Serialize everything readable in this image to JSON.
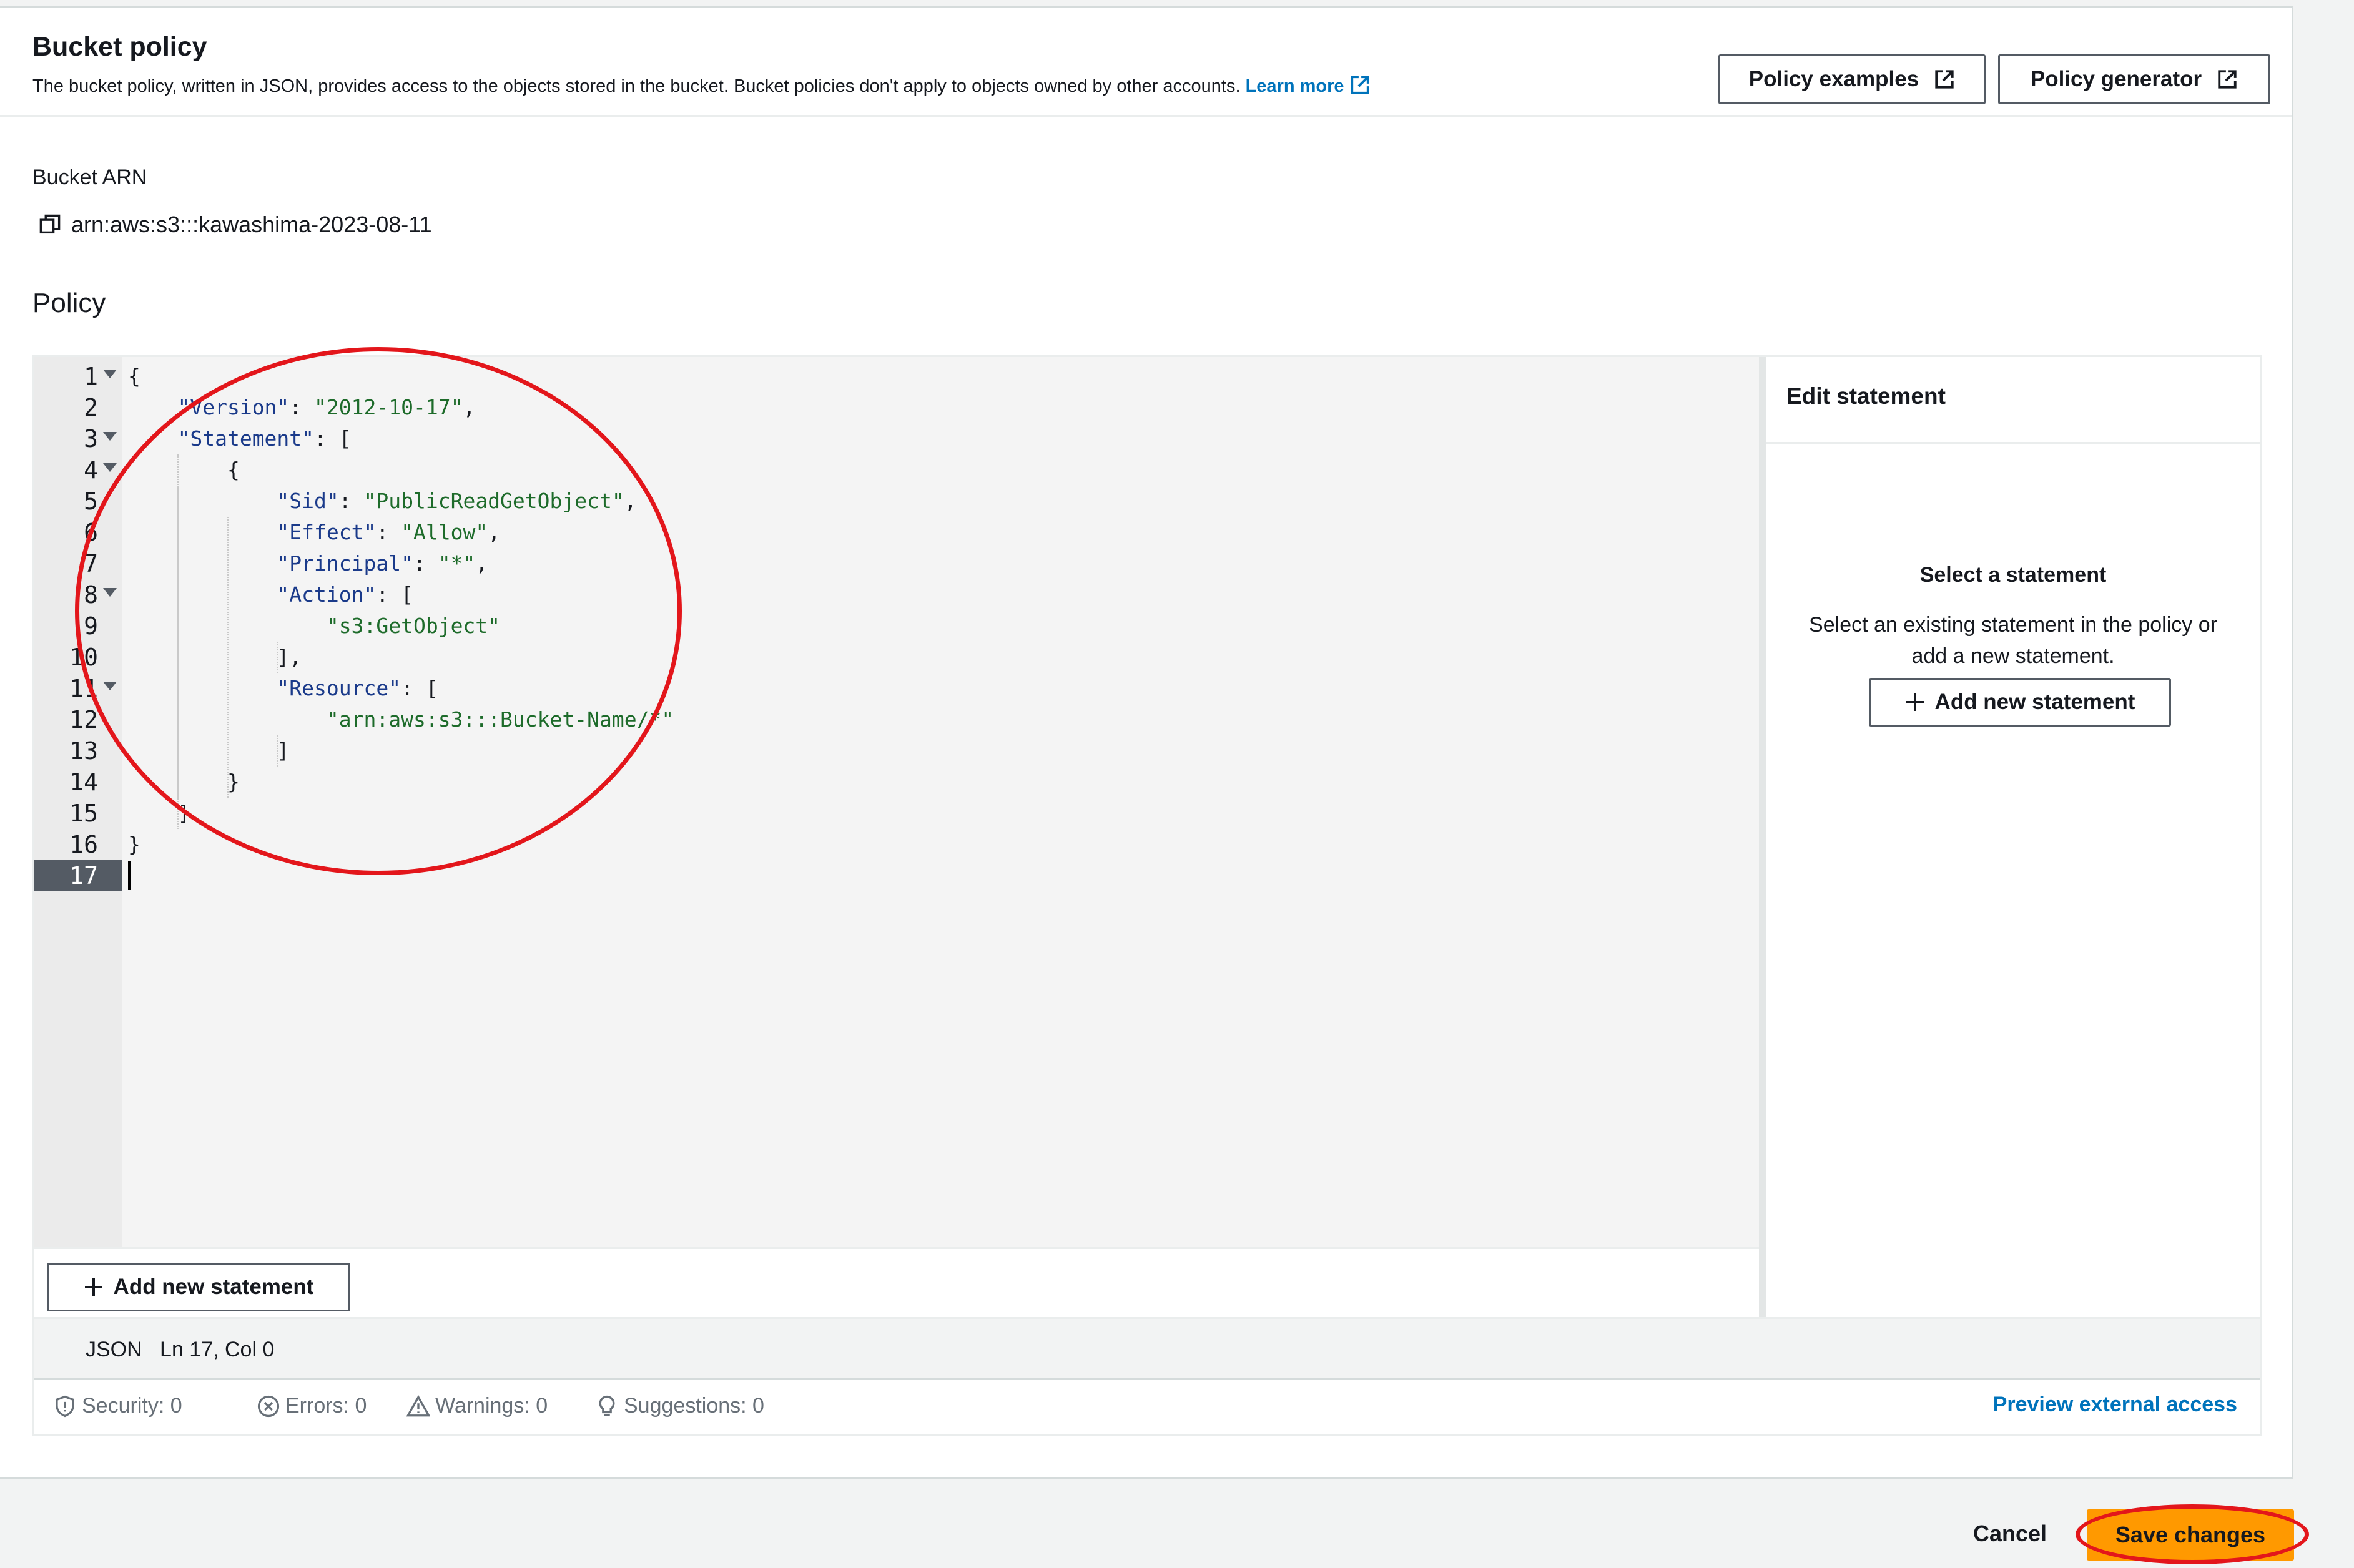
{
  "header": {
    "title": "Bucket policy",
    "description": "The bucket policy, written in JSON, provides access to the objects stored in the bucket. Bucket policies don't apply to objects owned by other accounts.",
    "learn_more": "Learn more",
    "policy_examples": "Policy examples",
    "policy_generator": "Policy generator"
  },
  "arn": {
    "label": "Bucket ARN",
    "value": "arn:aws:s3:::kawashima-2023-08-11"
  },
  "policy": {
    "label": "Policy"
  },
  "editor": {
    "line_numbers": [
      "1",
      "2",
      "3",
      "4",
      "5",
      "6",
      "7",
      "8",
      "9",
      "10",
      "11",
      "12",
      "13",
      "14",
      "15",
      "16",
      "17"
    ],
    "active_line": "17",
    "add_statement_label": "Add new statement",
    "status_mode": "JSON",
    "status_position": "Ln 17, Col 0"
  },
  "side_panel": {
    "title": "Edit statement",
    "empty_title": "Select a statement",
    "empty_description": "Select an existing statement in the policy or add a new statement.",
    "add_statement_label": "Add new statement"
  },
  "problems": {
    "security": "Security: 0",
    "errors": "Errors: 0",
    "warnings": "Warnings: 0",
    "suggestions": "Suggestions: 0",
    "preview_link": "Preview external access"
  },
  "footer": {
    "cancel": "Cancel",
    "save": "Save changes"
  },
  "colors": {
    "primary_button": "#ff9900",
    "link": "#0073bb",
    "annotation": "#e3161b",
    "json_key": "#1a3a8a",
    "json_string": "#1d6b2a"
  }
}
